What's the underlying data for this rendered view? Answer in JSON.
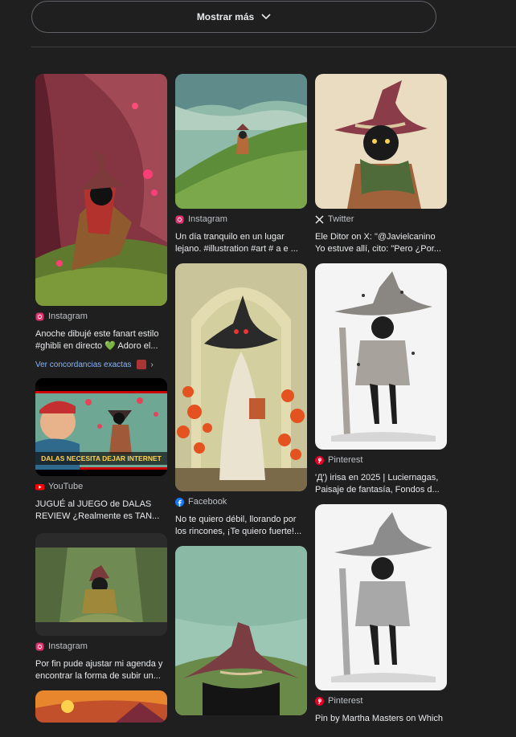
{
  "show_more": {
    "label": "Mostrar más"
  },
  "icons": {
    "chevron": "chevron-down-icon",
    "instagram": "instagram-icon",
    "twitter": "x-icon",
    "pinterest": "pinterest-icon",
    "youtube": "youtube-icon",
    "facebook": "facebook-icon"
  },
  "colors": {
    "background": "#1f1f1f",
    "link": "#8ab4f8",
    "instagram": "#e1306c",
    "youtube": "#ff0000",
    "pinterest": "#e60023",
    "facebook": "#1877f2"
  },
  "results": [
    {
      "source": "Instagram",
      "title1": "Anoche dibujé este fanart estilo",
      "title2": "#ghibli en directo 💚 Adoro el...",
      "exact_matches": "Ver concordancias exactas"
    },
    {
      "source": "YouTube",
      "title1": "JUGUÉ al JUEGO de DALAS",
      "title2": "REVIEW ¿Realmente es TAN...",
      "thumb_text": "DALAS NECESITA DEJAR INTERNET"
    },
    {
      "source": "Instagram",
      "title1": "Por fin pude ajustar mi agenda y",
      "title2": "encontrar la forma de subir un..."
    },
    {
      "source": "Instagram",
      "title1": "Un día tranquilo en un lugar",
      "title2": "lejano. #illustration #art # a  e ..."
    },
    {
      "source": "Facebook",
      "title1": "No te quiero débil, llorando por",
      "title2": "los rincones, ¡Te quiero fuerte!..."
    },
    {
      "source": "Twitter",
      "title1": "Ele Ditor on X: \"@Javielcanino",
      "title2": "Yo estuve allí, cito: \"Pero ¿Por..."
    },
    {
      "source": "Pinterest",
      "title1": "'Д') irisa en 2025 | Luciernagas,",
      "title2": "Paisaje de fantasía, Fondos d..."
    },
    {
      "source": "Pinterest",
      "title1": "Pin by Martha Masters on Which"
    }
  ]
}
